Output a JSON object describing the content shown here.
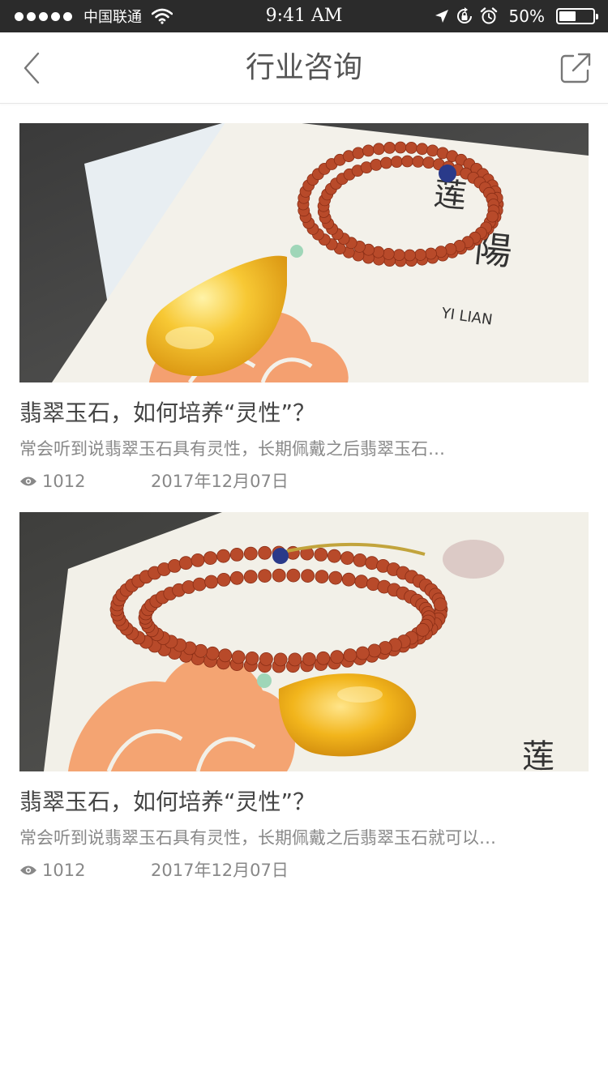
{
  "status_bar": {
    "carrier": "中国联通",
    "time": "9:41 AM",
    "battery_percent": "50%",
    "battery_level": 0.5,
    "icons": [
      "signal-dots-icon",
      "wifi-icon",
      "location-arrow-icon",
      "rotation-lock-icon",
      "alarm-icon",
      "battery-icon"
    ]
  },
  "nav": {
    "title": "行业咨询",
    "back_icon": "chevron-left-icon",
    "share_icon": "share-external-icon"
  },
  "articles": [
    {
      "image": "amber-pendant-red-bead-necklace-photo",
      "title": "翡翠玉石，如何培养“灵性”？",
      "summary": "常会听到说翡翠玉石具有灵性，长期佩戴之后翡翠玉石…",
      "views": "1012",
      "date": "2017年12月07日"
    },
    {
      "image": "amber-pendant-red-bead-necklace-photo",
      "title": "翡翠玉石，如何培养“灵性”？",
      "summary": "常会听到说翡翠玉石具有灵性，长期佩戴之后翡翠玉石就可以…",
      "views": "1012",
      "date": "2017年12月07日"
    }
  ],
  "colors": {
    "status_bar_bg": "#2b2b2b",
    "nav_bg": "#ffffff",
    "title_text": "#444444",
    "secondary_text": "#888888",
    "amber": "#f2b51c",
    "bead_red": "#b84a2a"
  }
}
